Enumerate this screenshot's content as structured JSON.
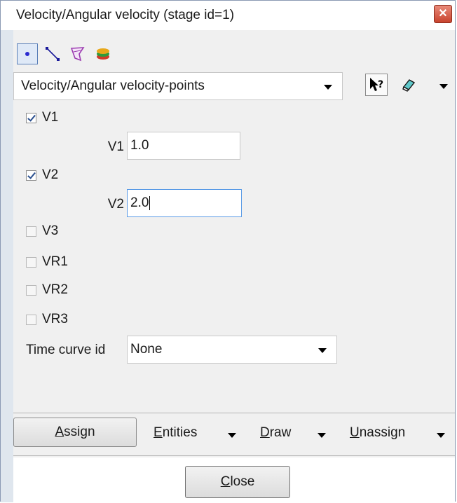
{
  "window": {
    "title": "Velocity/Angular velocity (stage id=1)",
    "close_glyph": "✕"
  },
  "toolbar": {
    "icons": [
      "point-select-icon",
      "line-select-icon",
      "surface-select-icon",
      "layers-icon"
    ]
  },
  "condition_select": {
    "value": "Velocity/Angular velocity-points"
  },
  "right_tools": {
    "help_glyph": "?",
    "icons": [
      "help-pointer-icon",
      "eraser-icon",
      "dropdown-arrow-icon"
    ]
  },
  "fields": {
    "v1_check": "V1",
    "v1_label": "V1",
    "v1_value": "1.0",
    "v2_check": "V2",
    "v2_label": "V2",
    "v2_value": "2.0",
    "v3_check": "V3",
    "vr1_check": "VR1",
    "vr2_check": "VR2",
    "vr3_check": "VR3",
    "time_curve_label": "Time curve id",
    "time_curve_value": "None"
  },
  "actions": {
    "assign_ul": "A",
    "assign_rest": "ssign",
    "entities_ul": "E",
    "entities_rest": "ntities",
    "draw_ul": "D",
    "draw_rest": "raw",
    "unassign_ul": "U",
    "unassign_rest": "nassign"
  },
  "footer": {
    "close_ul": "C",
    "close_rest": "lose"
  },
  "colors": {
    "accent": "#5a9be6",
    "close_red": "#c8432d"
  }
}
